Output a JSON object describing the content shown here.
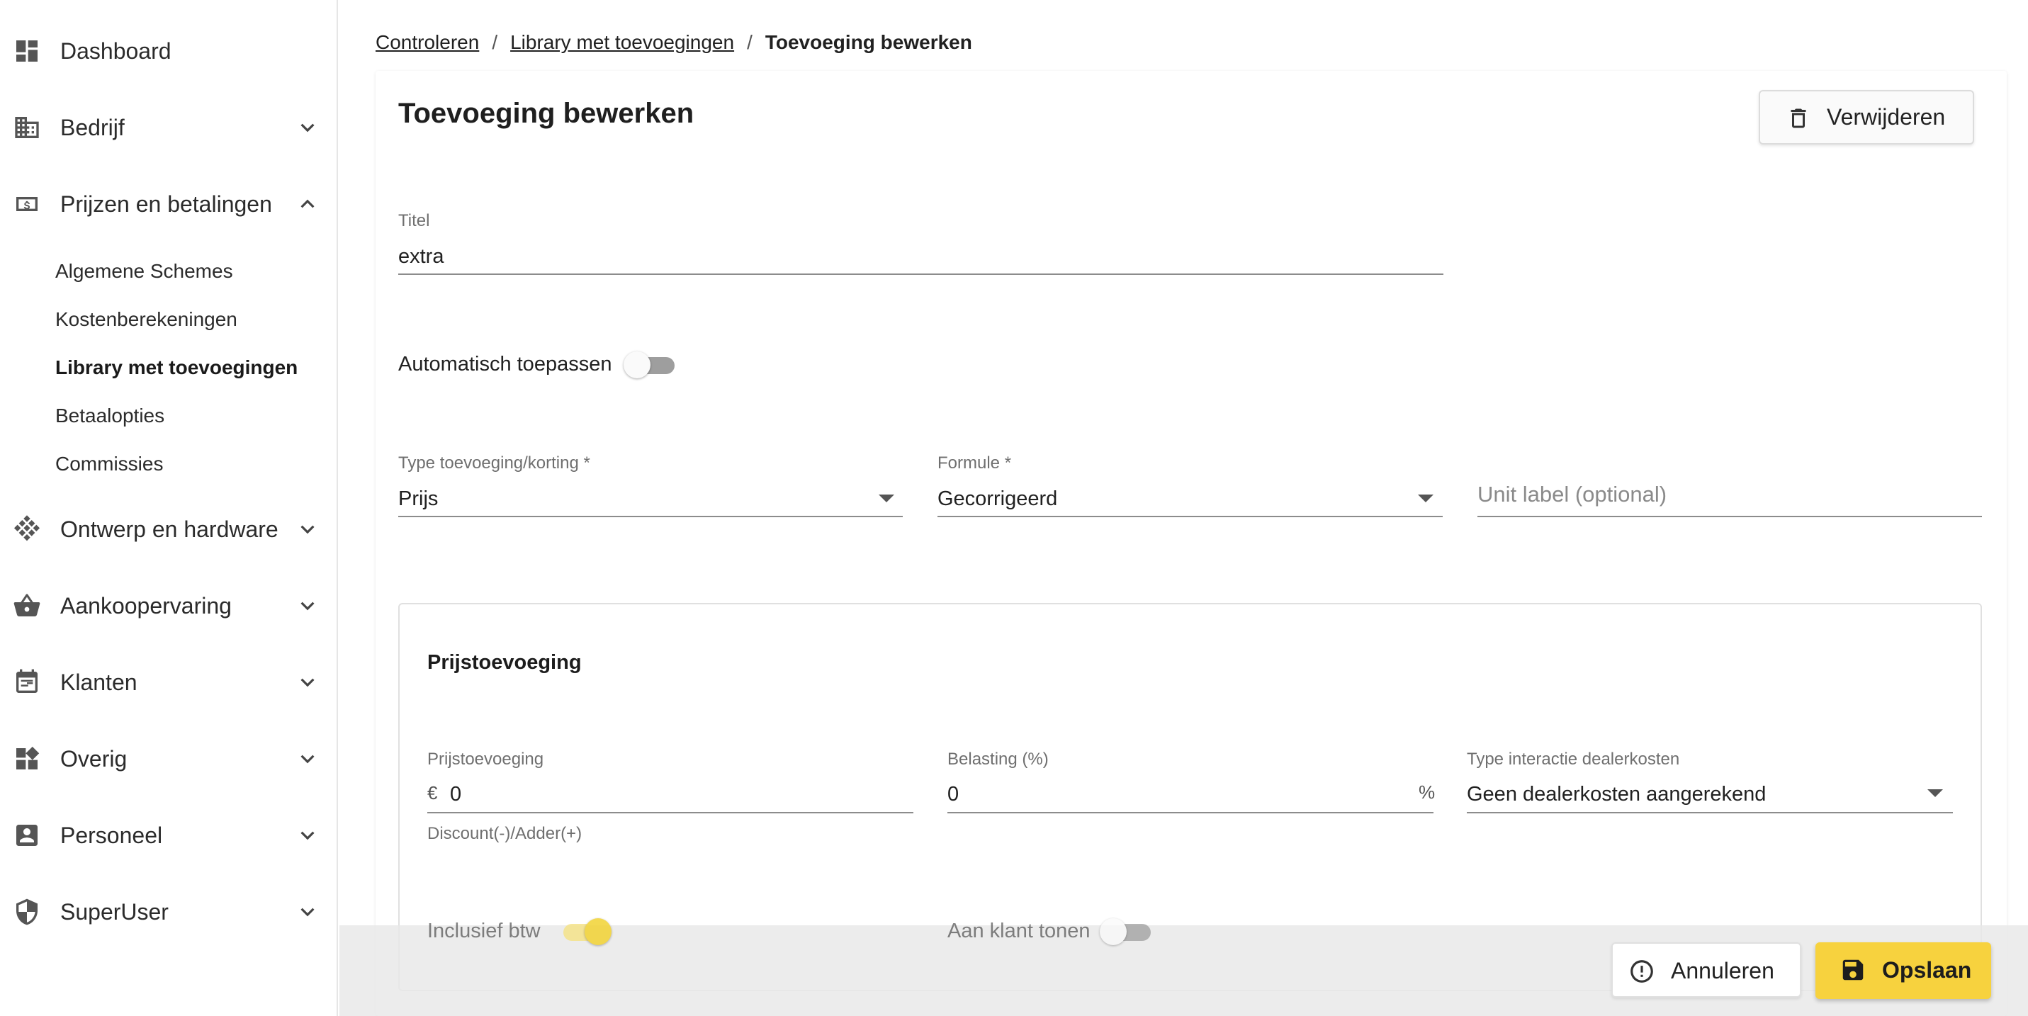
{
  "sidebar": {
    "items": [
      {
        "label": "Dashboard",
        "icon": "dashboard-icon"
      },
      {
        "label": "Bedrijf",
        "icon": "building-icon"
      },
      {
        "label": "Prijzen en betalingen",
        "icon": "money-icon"
      },
      {
        "label": "Ontwerp en hardware",
        "icon": "grid-diamond-icon"
      },
      {
        "label": "Aankoopervaring",
        "icon": "basket-icon"
      },
      {
        "label": "Klanten",
        "icon": "calendar-list-icon"
      },
      {
        "label": "Overig",
        "icon": "widgets-icon"
      },
      {
        "label": "Personeel",
        "icon": "person-badge-icon"
      },
      {
        "label": "SuperUser",
        "icon": "shield-icon"
      }
    ],
    "subitems": [
      {
        "label": "Algemene Schemes"
      },
      {
        "label": "Kostenberekeningen"
      },
      {
        "label": "Library met toevoegingen",
        "active": true
      },
      {
        "label": "Betaalopties"
      },
      {
        "label": "Commissies"
      }
    ]
  },
  "breadcrumb": {
    "crumbs": [
      "Controleren",
      "Library met toevoegingen"
    ],
    "separator": "/",
    "current": "Toevoeging bewerken"
  },
  "page": {
    "title": "Toevoeging bewerken",
    "delete_label": "Verwijderen"
  },
  "form": {
    "titel": {
      "label": "Titel",
      "value": "extra"
    },
    "auto_apply": {
      "label": "Automatisch toepassen",
      "on": false
    },
    "type": {
      "label": "Type toevoeging/korting *",
      "value": "Prijs"
    },
    "formule": {
      "label": "Formule *",
      "value": "Gecorrigeerd"
    },
    "unit_label": {
      "placeholder": "Unit label (optional)"
    }
  },
  "price_section": {
    "title": "Prijstoevoeging",
    "prijstoevoeging": {
      "label": "Prijstoevoeging",
      "prefix": "€",
      "value": "0",
      "helper": "Discount(-)/Adder(+)"
    },
    "belasting": {
      "label": "Belasting (%)",
      "value": "0",
      "suffix": "%"
    },
    "dealer": {
      "label": "Type interactie dealerkosten",
      "value": "Geen dealerkosten aangerekend"
    },
    "inclusief_btw": {
      "label": "Inclusief btw",
      "on": true
    },
    "aan_klant": {
      "label": "Aan klant tonen",
      "on": false
    }
  },
  "actions": {
    "cancel_label": "Annuleren",
    "save_label": "Opslaan"
  },
  "colors": {
    "accent": "#f7d23e",
    "toggle_on_thumb": "#f2d333",
    "toggle_off_track": "#9e9e9e"
  }
}
